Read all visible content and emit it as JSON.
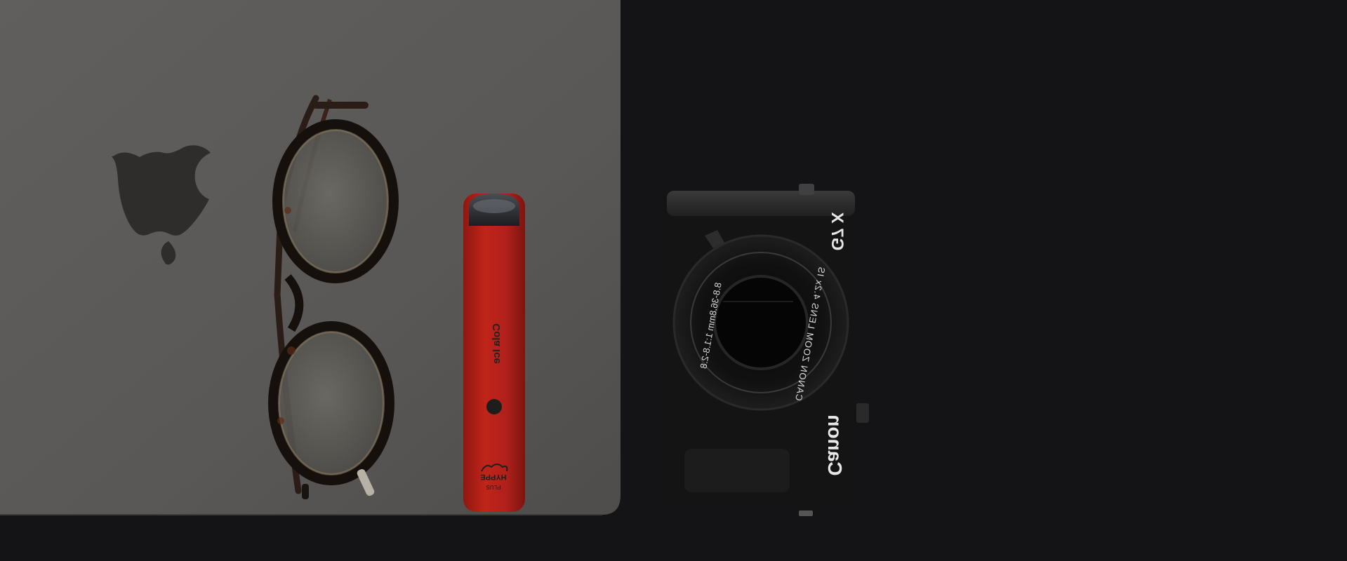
{
  "scene": {
    "description_kind": "flat-lay photo",
    "colors": {
      "background": "#141416",
      "laptop": "#5b5957",
      "vape_red": "#b11f16",
      "camera_body": "#151515"
    }
  },
  "vape": {
    "flavor_text": "Cola Ice",
    "logo_text": "HYPPE",
    "sub_logo_text": "PLUS"
  },
  "camera": {
    "model_text": "G7 X",
    "brand_text": "Canon",
    "lens_ring_text": "CANON ZOOM LENS 4.2x IS",
    "lens_spec_text": "8.8-36.8mm 1:1.8-2.8"
  }
}
